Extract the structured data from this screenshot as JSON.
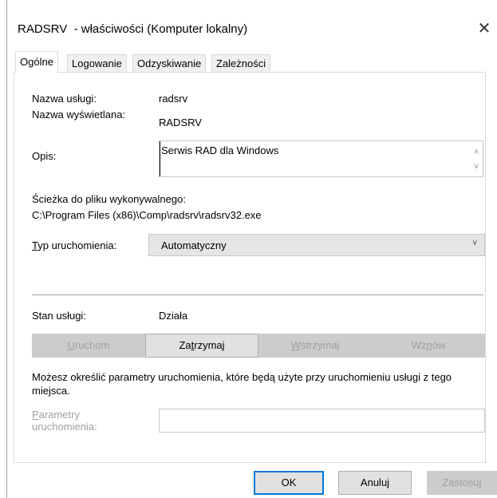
{
  "window": {
    "title": "RADSRV  - właściwości (Komputer lokalny)",
    "close_glyph": "✕"
  },
  "tabs": [
    {
      "label": "Ogólne",
      "active": true
    },
    {
      "label": "Logowanie",
      "active": false
    },
    {
      "label": "Odzyskiwanie",
      "active": false
    },
    {
      "label": "Zależności",
      "active": false
    }
  ],
  "general": {
    "service_name_label": "Nazwa usługi:",
    "service_name_value": "radsrv",
    "display_name_label": "Nazwa wyświetlana:",
    "display_name_value": "RADSRV",
    "description_label": "Opis:",
    "description_value": "Serwis RAD dla Windows",
    "path_label": "Ścieżka do pliku wykonywalnego:",
    "path_value": "C:\\Program Files (x86)\\Comp\\radsrv\\radsrv32.exe",
    "startup_type_label_pre": "T",
    "startup_type_label_post": "yp uruchomienia:",
    "startup_type_value": "Automatyczny",
    "status_label": "Stan usługi:",
    "status_value": "Działa",
    "buttons": {
      "start": {
        "pre": "",
        "accel": "U",
        "post": "ruchom",
        "enabled": false
      },
      "stop": {
        "pre": "Za",
        "accel": "t",
        "post": "rzymaj",
        "enabled": true
      },
      "pause": {
        "pre": "",
        "accel": "W",
        "post": "strzymaj",
        "enabled": false
      },
      "resume": {
        "pre": "Wz",
        "accel": "n",
        "post": "ów",
        "enabled": false
      }
    },
    "hint": "Możesz określić parametry uruchomienia, które będą użyte przy uruchomieniu usługi z tego miejsca.",
    "params_label_accel": "P",
    "params_label_rest": "arametry",
    "params_label_line2": "uruchomienia:",
    "params_value": ""
  },
  "footer": {
    "ok_label": "OK",
    "cancel_label": "Anuluj",
    "apply_label": "Zastosuj"
  },
  "colors": {
    "accent": "#0078d7",
    "disabled_text": "#a0a0a0",
    "button_bg": "#e1e1e1"
  },
  "icons": {
    "close": "close-icon",
    "chevron": "chevron-down-icon",
    "scroll_up": "scroll-up-icon",
    "scroll_down": "scroll-down-icon"
  }
}
